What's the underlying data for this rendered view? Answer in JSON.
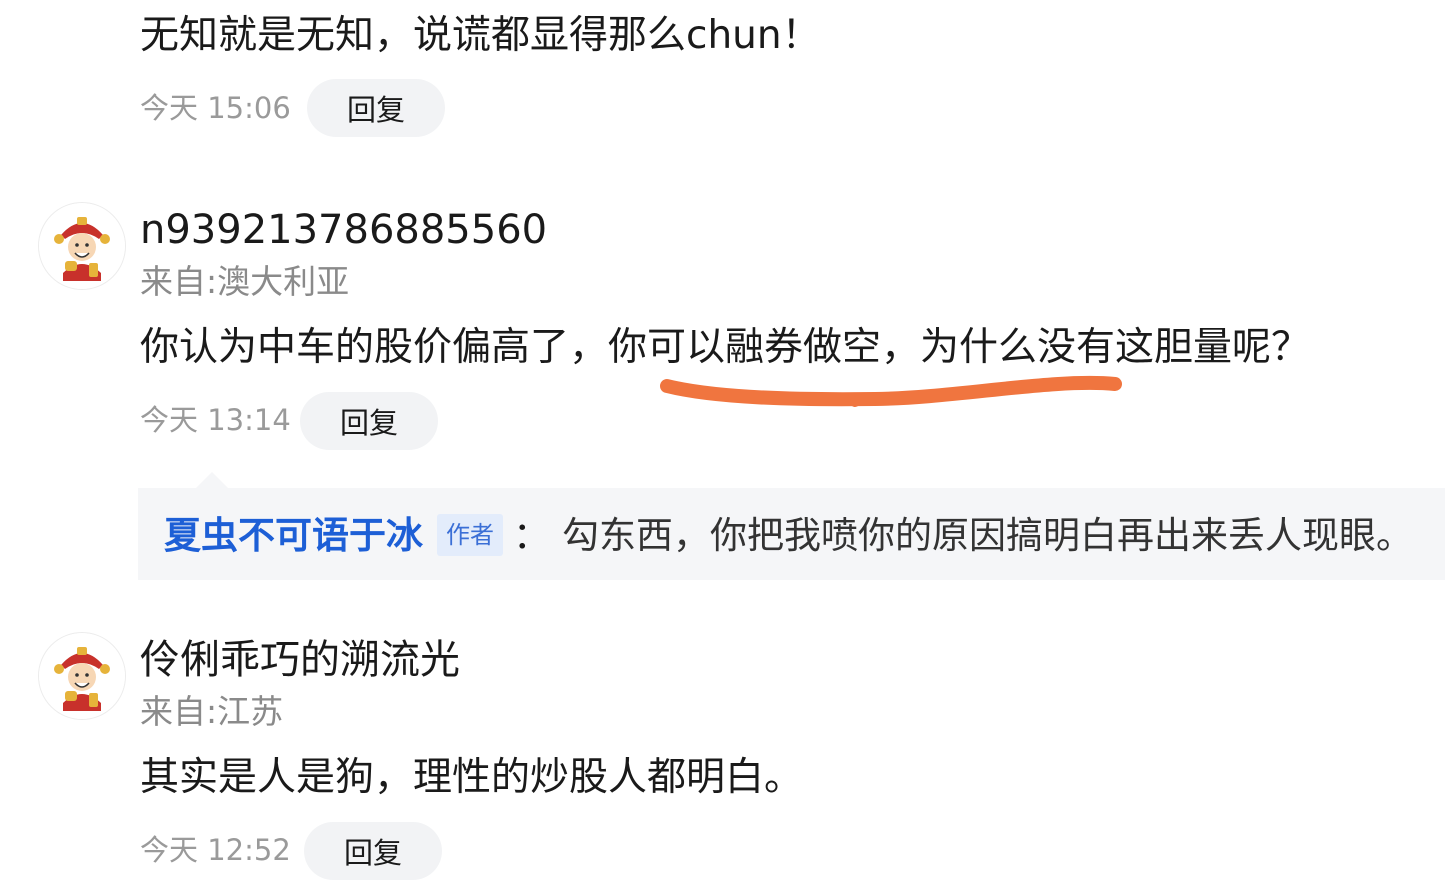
{
  "comments": [
    {
      "text": "无知就是无知，说谎都显得那么chun！",
      "time": "今天 15:06",
      "reply_label": "回复"
    },
    {
      "avatar_icon": "caishen-avatar-icon",
      "username": "n939213786885560",
      "location": "来自:澳大利亚",
      "text": "你认为中车的股价偏高了，你可以融券做空，为什么没有这胆量呢？",
      "time": "今天 13:14",
      "reply_label": "回复",
      "annotation_color": "#f0753f",
      "sub_reply": {
        "author": "夏虫不可语于冰",
        "author_tag": "作者",
        "separator": "：",
        "text": "勾东西，你把我喷你的原因搞明白再出来丢人现眼。"
      }
    },
    {
      "avatar_icon": "caishen-avatar-icon",
      "username": "伶俐乖巧的溯流光",
      "location": "来自:江苏",
      "text": "其实是人是狗，理性的炒股人都明白。",
      "time": "今天 12:52",
      "reply_label": "回复"
    }
  ],
  "colors": {
    "author_blue": "#1d5fd6",
    "tag_bg": "#e3ecfb",
    "button_bg": "#f2f3f5",
    "annotation": "#f0753f"
  }
}
